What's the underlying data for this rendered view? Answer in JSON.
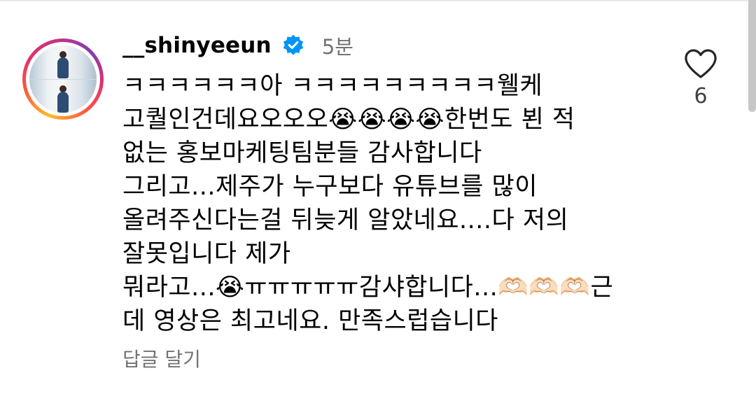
{
  "comment": {
    "username": "__shinyeeun",
    "time": "5분",
    "text": "ㅋㅋㅋㅋㅋㅋ아 ㅋㅋㅋㅋㅋㅋㅋㅋㅋ웰케\n고퀄인건데요오오오😭😭😭😭한번도 뵌 적\n없는 홍보마케팅팀분들 감사합니다\n그리고...제주가 누구보다 유튜브를 많이\n올려주신다는걸 뒤늦게 알았네요....다 저의\n잘못입니다 제가\n뭐라고...😭ㅠㅠㅠㅠㅠ감샤합니다...🫶🏻🫶🏻🫶🏻근\n데 영상은 최고네요. 만족스럽습니다",
    "reply_label": "답글 달기",
    "like_count": "6"
  },
  "icons": {
    "verified": "verified-badge-icon",
    "like": "heart-outline-icon",
    "verified_color": "#0095f6"
  }
}
